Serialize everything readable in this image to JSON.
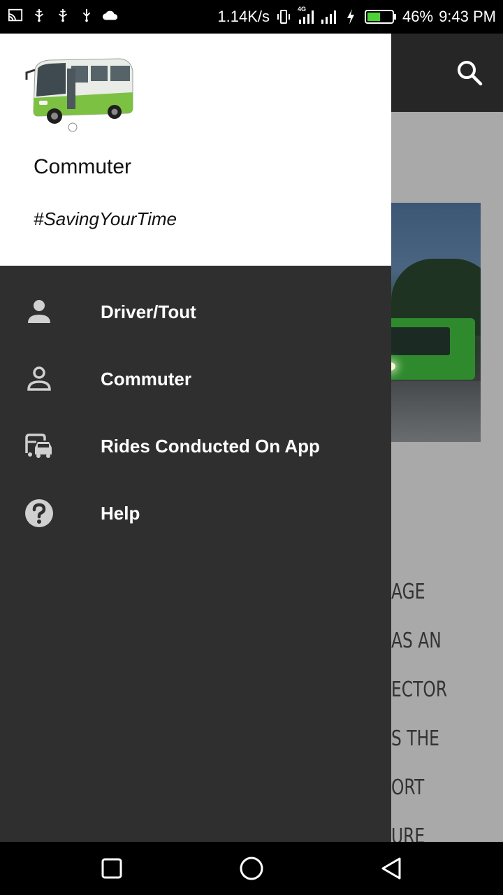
{
  "status_bar": {
    "net_speed": "1.14K/s",
    "network": "4G",
    "battery": "46%",
    "time": "9:43 PM"
  },
  "drawer": {
    "app_name": "Commuter",
    "tagline": "#SavingYourTime",
    "items": [
      {
        "label": "Driver/Tout",
        "icon": "person-filled-icon"
      },
      {
        "label": "Commuter",
        "icon": "person-outline-icon"
      },
      {
        "label": "Rides Conducted On App",
        "icon": "bus-car-icon"
      },
      {
        "label": "Help",
        "icon": "help-circle-icon"
      }
    ]
  },
  "background_text": [
    "AGE",
    "AS AN",
    "ECTOR",
    "S THE",
    "ORT",
    "URE"
  ],
  "colors": {
    "drawer": "#2f2f2f",
    "toolbar": "#262626",
    "accent_green": "#7dc142"
  }
}
